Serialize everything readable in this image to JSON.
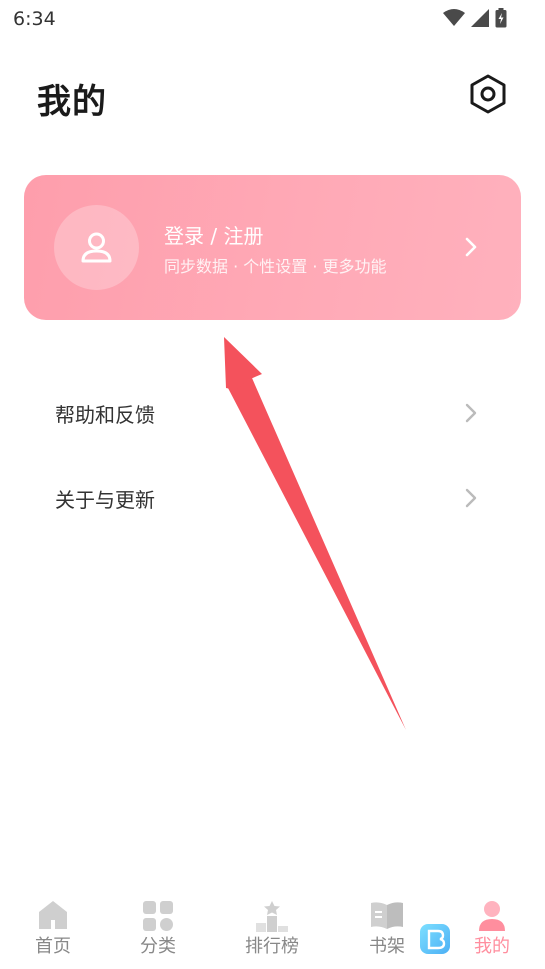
{
  "status_bar": {
    "time": "6:34",
    "icons": [
      "wifi-icon",
      "signal-icon",
      "battery-charging-icon"
    ]
  },
  "header": {
    "title": "我的",
    "settings_icon": "settings-hexagon-icon"
  },
  "login_card": {
    "title": "登录 / 注册",
    "subtitle": "同步数据 · 个性设置 · 更多功能",
    "avatar_icon": "user-icon",
    "chevron_icon": "chevron-right-icon",
    "gradient_start": "#fe9eac",
    "gradient_end": "#ffb1bd"
  },
  "menu": {
    "items": [
      {
        "label": "帮助和反馈",
        "icon": "chevron-right-icon"
      },
      {
        "label": "关于与更新",
        "icon": "chevron-right-icon"
      }
    ]
  },
  "annotation": {
    "arrow_color": "#f4525c"
  },
  "bottom_nav": {
    "items": [
      {
        "label": "首页",
        "icon": "home-icon",
        "active": false
      },
      {
        "label": "分类",
        "icon": "grid-icon",
        "active": false
      },
      {
        "label": "排行榜",
        "icon": "ranking-icon",
        "active": false
      },
      {
        "label": "书架",
        "icon": "book-icon",
        "active": false
      },
      {
        "label": "我的",
        "icon": "profile-icon",
        "active": true
      }
    ],
    "active_color": "#ff8e9e",
    "inactive_color": "#888888"
  }
}
